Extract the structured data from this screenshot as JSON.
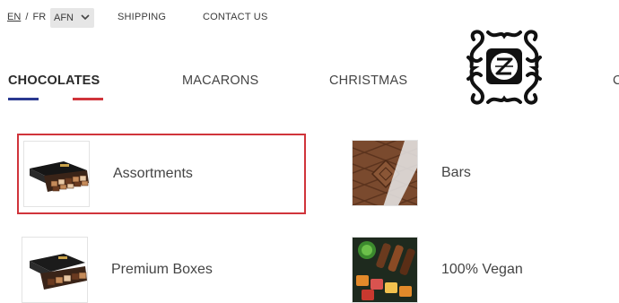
{
  "topbar": {
    "lang_en": "EN",
    "lang_sep": "/",
    "lang_fr": "FR",
    "currency": "AFN",
    "shipping": "SHIPPING",
    "contact": "CONTACT US"
  },
  "nav": {
    "items": [
      {
        "label": "CHOCOLATES",
        "active": true
      },
      {
        "label": "MACARONS"
      },
      {
        "label": "CHRISTMAS"
      },
      {
        "label": "C"
      }
    ]
  },
  "categories": [
    {
      "label": "Assortments",
      "selected": true,
      "icon": "assortment-box-image"
    },
    {
      "label": "Bars",
      "icon": "chocolate-bar-image"
    },
    {
      "label": "Premium Boxes",
      "icon": "premium-box-image"
    },
    {
      "label": "100% Vegan",
      "icon": "vegan-chocolates-image"
    }
  ],
  "colors": {
    "accent_blue": "#2a3990",
    "accent_red": "#d0343b",
    "text": "#3a3a3a"
  }
}
